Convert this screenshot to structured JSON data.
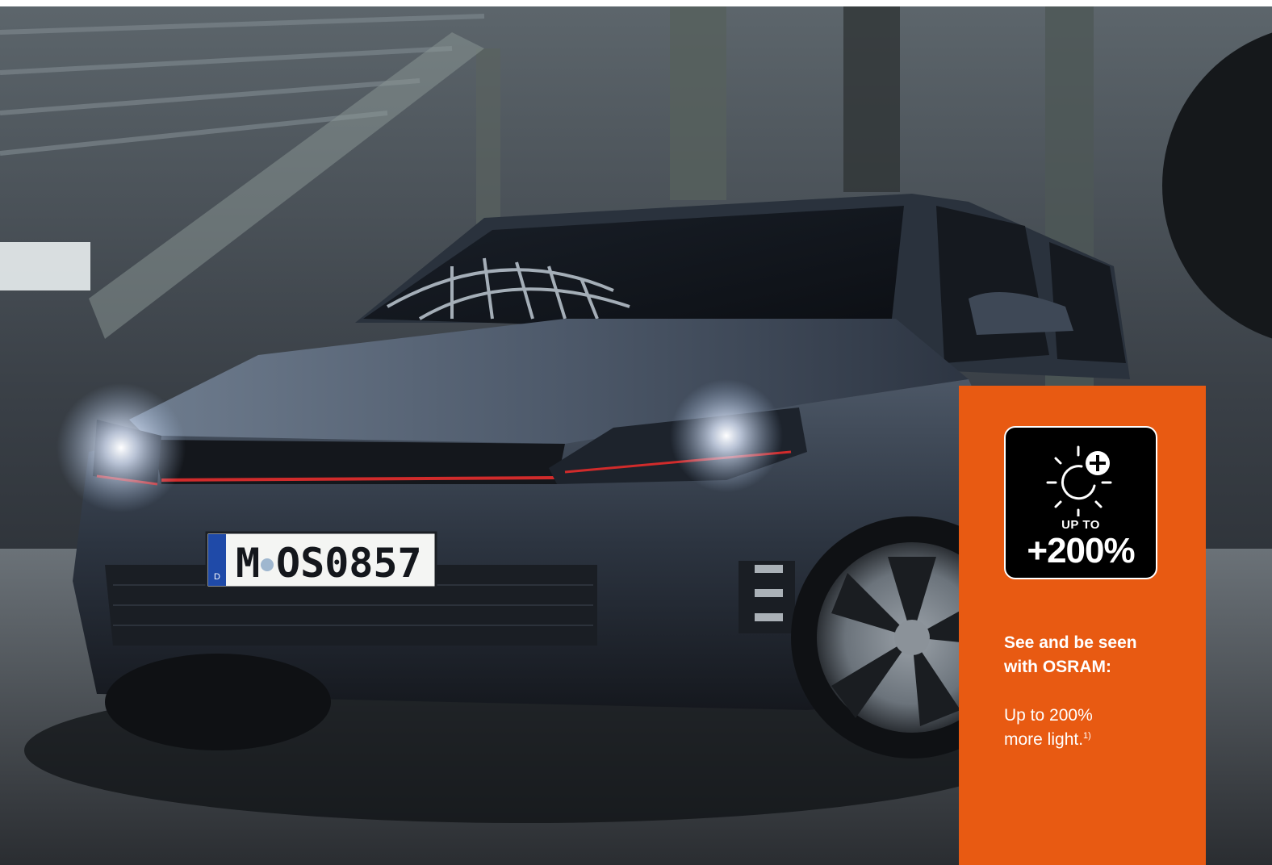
{
  "license_plate": {
    "country": "D",
    "city": "M",
    "number": "OS0857"
  },
  "badge": {
    "icon": "brightness-plus-icon",
    "up_to": "UP TO",
    "value": "+200%"
  },
  "panel": {
    "headline_line1": "See and be seen",
    "headline_line2": "with OSRAM:",
    "body_line1": "Up to 200%",
    "body_line2": "more light.",
    "footnote": "1)"
  },
  "colors": {
    "panel_orange": "#e85a12",
    "badge_black": "#000000",
    "grille_red": "#d12b2b"
  }
}
